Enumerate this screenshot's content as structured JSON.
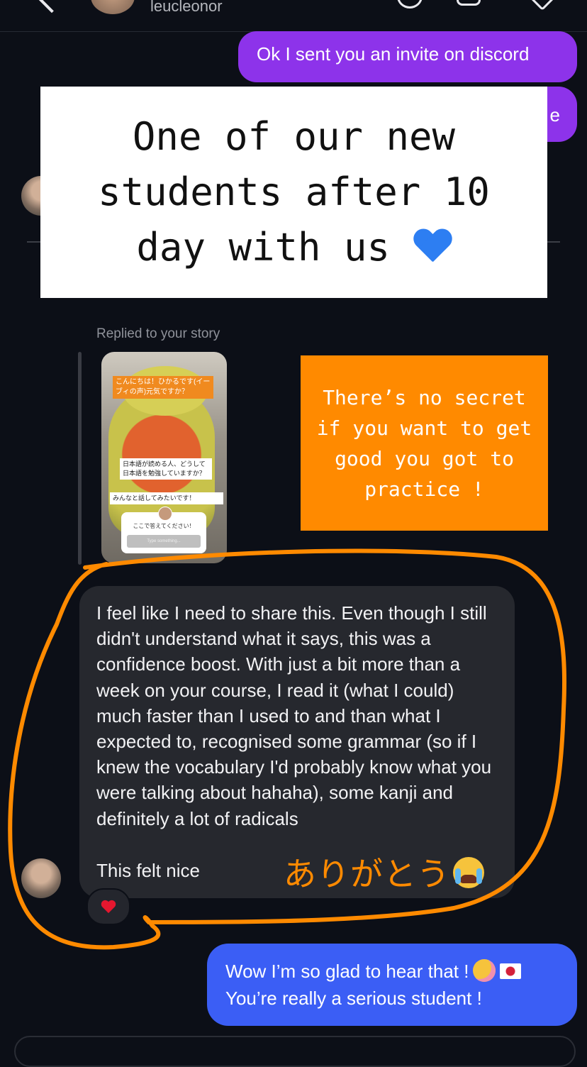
{
  "header": {
    "username": "leucleonor"
  },
  "messages": {
    "out1": "Ok I sent you an invite on discord",
    "out2_visible_fragment": "e",
    "story_reply_label": "Replied to your story",
    "incoming_text": "I feel like I need to share this. Even though I still didn't understand what it says, this was a confidence boost. With just a bit more than a week on your course, I read it (what I could) much faster than I used to and than what I expected to, recognised some grammar (so if I knew the vocabulary I'd probably know what you were talking about hahaha), some kanji and definitely a lot of radicals",
    "incoming_text_2": "This felt nice",
    "reaction": "heart",
    "reply_line1": "Wow I’m so glad to hear that !",
    "reply_line2": "You’re really a serious student !"
  },
  "story": {
    "tag1": "こんにちは！ひかるです(イーブィの声)元気ですか？",
    "tag2": "日本語が読める人、どうして日本語を勉強していますか？",
    "tag3": "みんなと話してみたいです！",
    "question_title": "ここで答えてください！",
    "question_input": "Type something..."
  },
  "overlays": {
    "title": "One of our new students after 10 day with us",
    "orange_note": "There’s no secret if you want to get good you got to practice !",
    "annotation": "ありがとう"
  },
  "colors": {
    "background": "#0c0f17",
    "outgoing_purple": "#8d33ea",
    "outgoing_blue": "#3b5ef5",
    "incoming": "#26282e",
    "annotation_orange": "#ff8a00"
  },
  "icons": [
    "back-icon",
    "call-icon",
    "video-icon",
    "tag-icon",
    "heart-icon",
    "blue-heart-emoji",
    "crying-emoji",
    "smiling-hearts-emoji",
    "japan-flag-emoji"
  ]
}
